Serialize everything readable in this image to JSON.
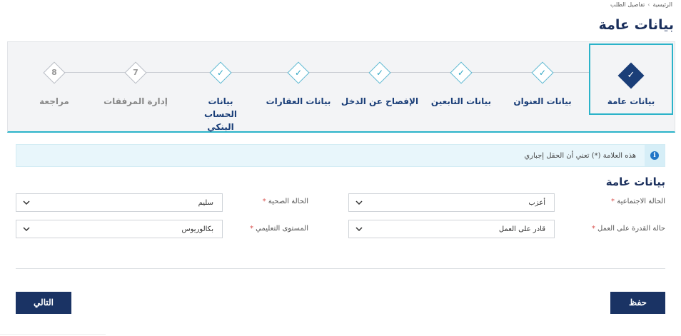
{
  "breadcrumb": {
    "home": "الرئيسية",
    "separator": "›",
    "current": "تفاصيل الطلب"
  },
  "page": {
    "title": "بيانات عامة"
  },
  "stepper": {
    "steps": [
      {
        "label": "بيانات عامة",
        "state": "active",
        "glyph": "✓"
      },
      {
        "label": "بيانات العنوان",
        "state": "done",
        "glyph": "✓"
      },
      {
        "label": "بيانات التابعين",
        "state": "done",
        "glyph": "✓"
      },
      {
        "label": "الإفصاح عن الدخل",
        "state": "done",
        "glyph": "✓"
      },
      {
        "label": "بيانات العقارات",
        "state": "done",
        "glyph": "✓"
      },
      {
        "label": "بيانات الحساب البنكي",
        "state": "done",
        "glyph": "✓"
      },
      {
        "label": "إدارة المرفقات",
        "state": "future",
        "glyph": "7"
      },
      {
        "label": "مراجعة",
        "state": "future",
        "glyph": "8"
      }
    ]
  },
  "info": {
    "text": "هذه العلامة (*) تعني أن الحقل إجباري",
    "icon": "info-icon"
  },
  "form": {
    "section_title": "بيانات عامة",
    "marital_status": {
      "label": "الحالة الاجتماعية",
      "required": "*",
      "value": "أعزب"
    },
    "health_status": {
      "label": "الحالة الصحية",
      "required": "*",
      "value": "سليم"
    },
    "work_ability": {
      "label": "حالة القدرة على العمل",
      "required": "*",
      "value": "قادر على العمل"
    },
    "education_level": {
      "label": "المستوى التعليمي",
      "required": "*",
      "value": "بكالوريوس"
    }
  },
  "actions": {
    "save_label": "حفظ",
    "next_label": "التالي"
  },
  "colors": {
    "primary": "#1a3364",
    "accent": "#2bb3c9",
    "done": "#2aa3c2",
    "required": "#d9534f"
  }
}
